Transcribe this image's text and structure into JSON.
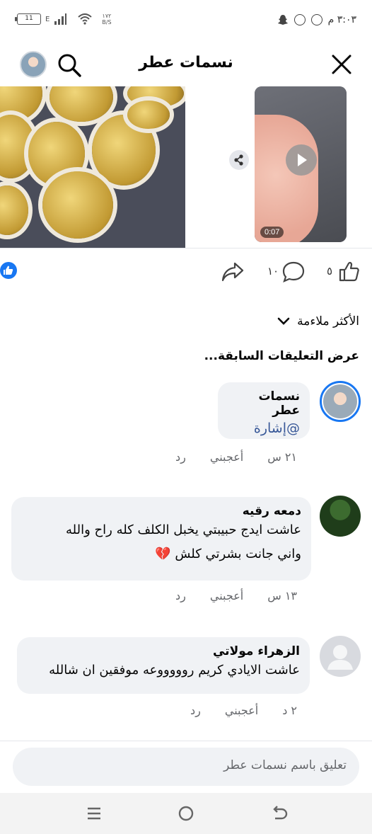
{
  "status_bar": {
    "time": "٣:٠٣ م",
    "battery": "11",
    "network": "E",
    "speed_value": "١٧٢",
    "speed_unit": "B/S"
  },
  "header": {
    "title": "نسمات عطر"
  },
  "media": {
    "video_duration": "0:07"
  },
  "actions": {
    "like_count": "٥",
    "comment_count": "١٠"
  },
  "sort": {
    "label": "الأكثر ملاءمة"
  },
  "previous_comments_label": "عرض التعليقات السابقة...",
  "comments": [
    {
      "author": "نسمات عطر",
      "mention": "@إشارة",
      "time": "٢١ س",
      "like_label": "أعجبني",
      "reply_label": "رد"
    },
    {
      "author": "دمعه رقيه",
      "text_line1": "عاشت ايدج حبيبتي يخبل الكلف كله راح والله",
      "text_line2": "واني جانت بشرتي كلش 💔",
      "time": "١٣ س",
      "like_label": "أعجبني",
      "reply_label": "رد"
    },
    {
      "author": "الزهراء مولاتي",
      "text_line1": "عاشت الايادي كريم روووووعه موفقين ان شالله",
      "time": "٢ د",
      "like_label": "أعجبني",
      "reply_label": "رد"
    }
  ],
  "composer": {
    "placeholder": "تعليق باسم نسمات عطر"
  },
  "colors": {
    "accent": "#1877f2",
    "bubble": "#f0f2f5",
    "mention": "#385898"
  }
}
